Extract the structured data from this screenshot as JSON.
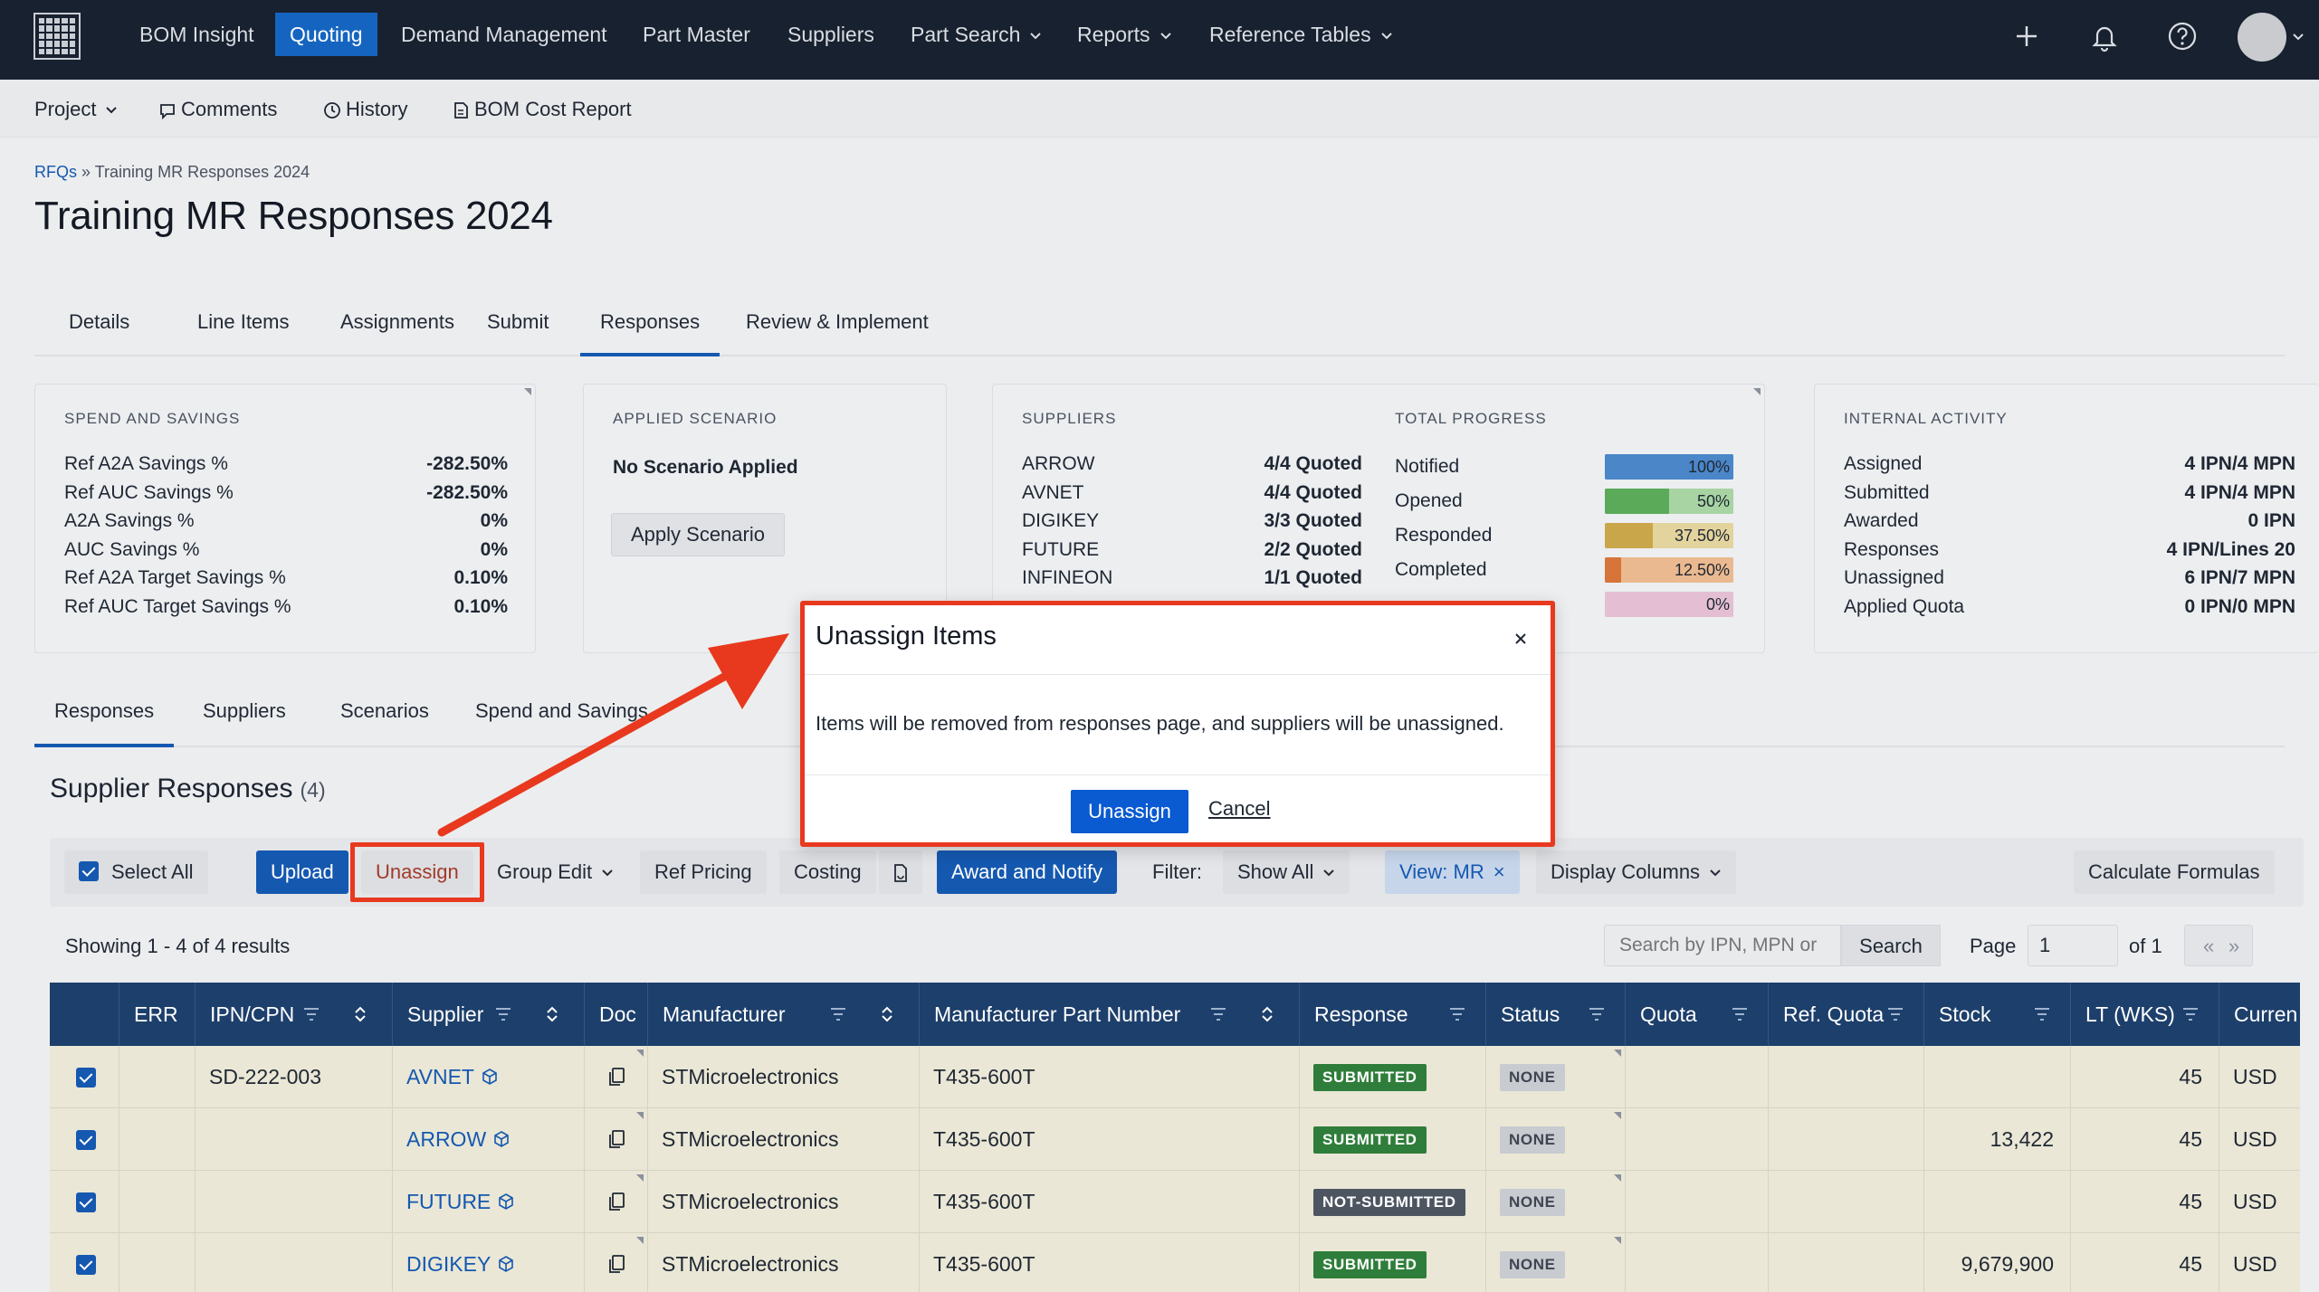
{
  "topnav": {
    "items": [
      {
        "label": "BOM Insight"
      },
      {
        "label": "Quoting"
      },
      {
        "label": "Demand Management"
      },
      {
        "label": "Part Master"
      },
      {
        "label": "Suppliers"
      },
      {
        "label": "Part Search"
      },
      {
        "label": "Reports"
      },
      {
        "label": "Reference Tables"
      }
    ],
    "active": "Quoting"
  },
  "subnav": {
    "project": "Project",
    "comments": "Comments",
    "history": "History",
    "cost_report": "BOM Cost Report"
  },
  "breadcrumb": {
    "root": "RFQs",
    "sep": "»",
    "current": "Training MR Responses 2024"
  },
  "page_title": "Training MR Responses 2024",
  "tabs": [
    "Details",
    "Line Items",
    "Assignments",
    "Submit",
    "Responses",
    "Review & Implement"
  ],
  "active_tab": "Responses",
  "spend": {
    "title": "SPEND AND SAVINGS",
    "rows": [
      {
        "label": "Ref A2A Savings %",
        "value": "-282.50%"
      },
      {
        "label": "Ref AUC Savings %",
        "value": "-282.50%"
      },
      {
        "label": "A2A Savings %",
        "value": "0%"
      },
      {
        "label": "AUC Savings %",
        "value": "0%"
      },
      {
        "label": "Ref A2A Target Savings %",
        "value": "0.10%"
      },
      {
        "label": "Ref AUC Target Savings %",
        "value": "0.10%"
      }
    ]
  },
  "scenario": {
    "title": "APPLIED SCENARIO",
    "status": "No Scenario Applied",
    "button": "Apply Scenario"
  },
  "suppliers_card": {
    "title": "SUPPLIERS",
    "rows": [
      {
        "name": "ARROW",
        "value": "4/4 Quoted"
      },
      {
        "name": "AVNET",
        "value": "4/4 Quoted"
      },
      {
        "name": "DIGIKEY",
        "value": "3/3 Quoted"
      },
      {
        "name": "FUTURE",
        "value": "2/2 Quoted"
      },
      {
        "name": "INFINEON",
        "value": "1/1 Quoted"
      }
    ]
  },
  "progress": {
    "title": "TOTAL PROGRESS",
    "rows": [
      {
        "label": "Notified",
        "pct_text": "100%",
        "fraction": 1.0,
        "color": "#4a86c8",
        "track": "#4a86c8"
      },
      {
        "label": "Opened",
        "pct_text": "50%",
        "fraction": 0.5,
        "color": "#5aaa5a",
        "track": "#a8d4a4"
      },
      {
        "label": "Responded",
        "pct_text": "37.50%",
        "fraction": 0.375,
        "color": "#caa64a",
        "track": "#e3d39d"
      },
      {
        "label": "Completed",
        "pct_text": "12.50%",
        "fraction": 0.125,
        "color": "#d6743a",
        "track": "#eab98f"
      },
      {
        "label": "",
        "pct_text": "0%",
        "fraction": 0,
        "color": "#c98ab0",
        "track": "#e4bfd4"
      }
    ]
  },
  "internal": {
    "title": "INTERNAL ACTIVITY",
    "rows": [
      {
        "label": "Assigned",
        "value": "4 IPN/4 MPN"
      },
      {
        "label": "Submitted",
        "value": "4 IPN/4 MPN"
      },
      {
        "label": "Awarded",
        "value": "0 IPN"
      },
      {
        "label": "Responses",
        "value": "4 IPN/Lines 20"
      },
      {
        "label": "Unassigned",
        "value": "6 IPN/7 MPN"
      },
      {
        "label": "Applied Quota",
        "value": "0 IPN/0 MPN"
      }
    ]
  },
  "subtabs": [
    "Responses",
    "Suppliers",
    "Scenarios",
    "Spend and Savings"
  ],
  "active_subtab": "Responses",
  "section": {
    "title": "Supplier Responses",
    "count": "(4)"
  },
  "toolbar": {
    "select_all": "Select All",
    "upload": "Upload",
    "unassign": "Unassign",
    "group_edit": "Group Edit",
    "ref_pricing": "Ref Pricing",
    "costing": "Costing",
    "award": "Award and Notify",
    "filter_label": "Filter:",
    "filter_value": "Show All",
    "view_pill": "View: MR",
    "display_columns": "Display Columns",
    "calc": "Calculate Formulas"
  },
  "results": {
    "showing": "Showing 1 - 4 of 4 results",
    "search_placeholder": "Search by IPN, MPN or",
    "search_button": "Search",
    "page_label": "Page",
    "page_value": "1",
    "page_of": "of 1",
    "prev": "«",
    "next": "»"
  },
  "table": {
    "columns": [
      "ERR",
      "IPN/CPN",
      "Supplier",
      "Doc",
      "Manufacturer",
      "Manufacturer Part Number",
      "Response",
      "Status",
      "Quota",
      "Ref. Quota",
      "Stock",
      "LT (WKS)",
      "Curren"
    ],
    "rows": [
      {
        "ipn": "SD-222-003",
        "supplier": "AVNET",
        "manufacturer": "STMicroelectronics",
        "mpn": "T435-600T",
        "response": "SUBMITTED",
        "status": "NONE",
        "stock": "",
        "lt": "45",
        "currency": "USD"
      },
      {
        "ipn": "",
        "supplier": "ARROW",
        "manufacturer": "STMicroelectronics",
        "mpn": "T435-600T",
        "response": "SUBMITTED",
        "status": "NONE",
        "stock": "13,422",
        "lt": "45",
        "currency": "USD"
      },
      {
        "ipn": "",
        "supplier": "FUTURE",
        "manufacturer": "STMicroelectronics",
        "mpn": "T435-600T",
        "response": "NOT-SUBMITTED",
        "status": "NONE",
        "stock": "",
        "lt": "45",
        "currency": "USD"
      },
      {
        "ipn": "",
        "supplier": "DIGIKEY",
        "manufacturer": "STMicroelectronics",
        "mpn": "T435-600T",
        "response": "SUBMITTED",
        "status": "NONE",
        "stock": "9,679,900",
        "lt": "45",
        "currency": "USD"
      }
    ]
  },
  "modal": {
    "title": "Unassign Items",
    "body": "Items will be removed from responses page, and suppliers will be unassigned.",
    "confirm": "Unassign",
    "cancel": "Cancel",
    "close": "×"
  },
  "annotation_color": "#e8391f"
}
